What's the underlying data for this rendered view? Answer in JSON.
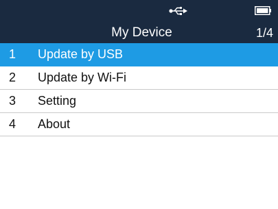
{
  "status_bar": {
    "icons": [
      "usb-icon",
      "battery-icon"
    ]
  },
  "header": {
    "title": "My Device",
    "page_indicator": "1/4"
  },
  "menu": {
    "selected_index": 0,
    "items": [
      {
        "number": "1",
        "label": "Update by USB"
      },
      {
        "number": "2",
        "label": "Update by Wi-Fi"
      },
      {
        "number": "3",
        "label": "Setting"
      },
      {
        "number": "4",
        "label": "About"
      }
    ]
  },
  "colors": {
    "header_bg": "#1a2a40",
    "selected_bg": "#1e9be4",
    "text": "#111111",
    "divider": "#c9c9c9"
  }
}
